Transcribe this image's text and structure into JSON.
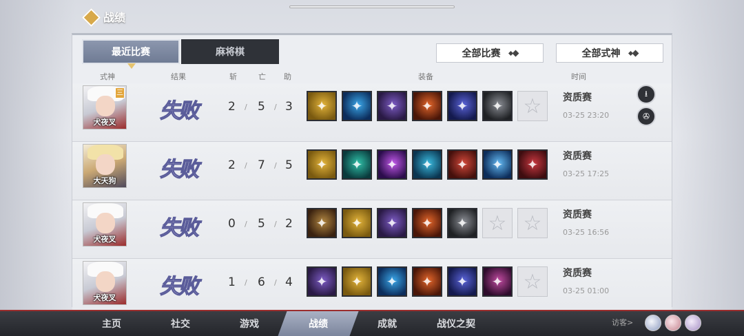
{
  "header": {
    "title": "战绩"
  },
  "tabs": [
    {
      "label": "最近比赛"
    },
    {
      "label": "麻将棋"
    }
  ],
  "filters": {
    "matches": "全部比赛",
    "shikigami": "全部式神"
  },
  "columns": {
    "shikigami": "式神",
    "result": "结果",
    "kills": "斩",
    "deaths": "亡",
    "assists": "助",
    "equipment": "装备",
    "time": "时间"
  },
  "matches": [
    {
      "hero": "犬夜叉",
      "rank": "三",
      "result": "失败",
      "kills": "2",
      "deaths": "5",
      "assists": "3",
      "type": "资质赛",
      "time": "03-25 23:20",
      "items": [
        "gold",
        "blue",
        "purple",
        "orange",
        "indigo",
        "gray",
        "empty"
      ]
    },
    {
      "hero": "大天狗",
      "rank": "",
      "result": "失败",
      "kills": "2",
      "deaths": "7",
      "assists": "5",
      "type": "资质赛",
      "time": "03-25 17:25",
      "items": [
        "gold",
        "teal",
        "violet",
        "cyan",
        "red",
        "azure",
        "crimson"
      ]
    },
    {
      "hero": "犬夜叉",
      "rank": "",
      "result": "失败",
      "kills": "0",
      "deaths": "5",
      "assists": "2",
      "type": "资质赛",
      "time": "03-25 16:56",
      "items": [
        "brown",
        "gold",
        "purple",
        "orange",
        "gray",
        "empty",
        "empty"
      ]
    },
    {
      "hero": "犬夜叉",
      "rank": "",
      "result": "失败",
      "kills": "1",
      "deaths": "6",
      "assists": "4",
      "type": "资质赛",
      "time": "03-25 01:00",
      "items": [
        "purple",
        "gold",
        "blue",
        "orange",
        "indigo",
        "magenta",
        "empty"
      ]
    }
  ],
  "nav": [
    "主页",
    "社交",
    "游戏",
    "战绩",
    "成就",
    "战仪之契"
  ],
  "nav_active": "战绩",
  "visitor_label": "访客>",
  "icons": {
    "download": "download-icon",
    "replay": "film-reel-icon",
    "empty_slot": "star-icon"
  }
}
